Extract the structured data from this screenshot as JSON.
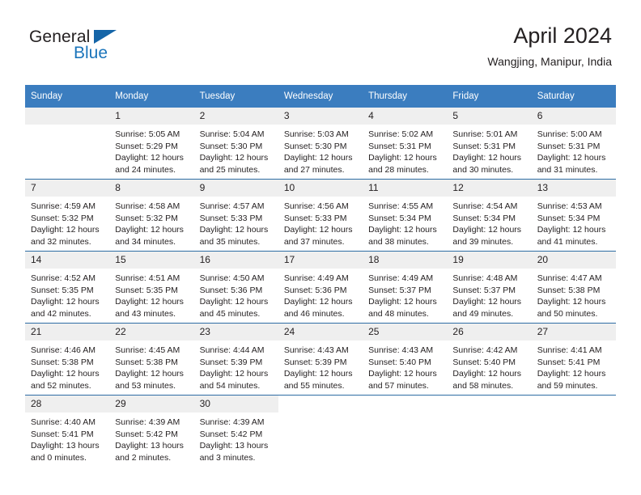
{
  "brand": {
    "name_part1": "General",
    "name_part2": "Blue",
    "accent_color": "#1b75bb"
  },
  "header": {
    "title": "April 2024",
    "subtitle": "Wangjing, Manipur, India"
  },
  "calendar": {
    "header_bg_color": "#3b7dbf",
    "daynum_bg_color": "#efefef",
    "separator_color": "#2e6da4",
    "weekday_headers": [
      "Sunday",
      "Monday",
      "Tuesday",
      "Wednesday",
      "Thursday",
      "Friday",
      "Saturday"
    ],
    "weeks": [
      [
        {
          "day": "",
          "lines": []
        },
        {
          "day": "1",
          "lines": [
            "Sunrise: 5:05 AM",
            "Sunset: 5:29 PM",
            "Daylight: 12 hours",
            "and 24 minutes."
          ]
        },
        {
          "day": "2",
          "lines": [
            "Sunrise: 5:04 AM",
            "Sunset: 5:30 PM",
            "Daylight: 12 hours",
            "and 25 minutes."
          ]
        },
        {
          "day": "3",
          "lines": [
            "Sunrise: 5:03 AM",
            "Sunset: 5:30 PM",
            "Daylight: 12 hours",
            "and 27 minutes."
          ]
        },
        {
          "day": "4",
          "lines": [
            "Sunrise: 5:02 AM",
            "Sunset: 5:31 PM",
            "Daylight: 12 hours",
            "and 28 minutes."
          ]
        },
        {
          "day": "5",
          "lines": [
            "Sunrise: 5:01 AM",
            "Sunset: 5:31 PM",
            "Daylight: 12 hours",
            "and 30 minutes."
          ]
        },
        {
          "day": "6",
          "lines": [
            "Sunrise: 5:00 AM",
            "Sunset: 5:31 PM",
            "Daylight: 12 hours",
            "and 31 minutes."
          ]
        }
      ],
      [
        {
          "day": "7",
          "lines": [
            "Sunrise: 4:59 AM",
            "Sunset: 5:32 PM",
            "Daylight: 12 hours",
            "and 32 minutes."
          ]
        },
        {
          "day": "8",
          "lines": [
            "Sunrise: 4:58 AM",
            "Sunset: 5:32 PM",
            "Daylight: 12 hours",
            "and 34 minutes."
          ]
        },
        {
          "day": "9",
          "lines": [
            "Sunrise: 4:57 AM",
            "Sunset: 5:33 PM",
            "Daylight: 12 hours",
            "and 35 minutes."
          ]
        },
        {
          "day": "10",
          "lines": [
            "Sunrise: 4:56 AM",
            "Sunset: 5:33 PM",
            "Daylight: 12 hours",
            "and 37 minutes."
          ]
        },
        {
          "day": "11",
          "lines": [
            "Sunrise: 4:55 AM",
            "Sunset: 5:34 PM",
            "Daylight: 12 hours",
            "and 38 minutes."
          ]
        },
        {
          "day": "12",
          "lines": [
            "Sunrise: 4:54 AM",
            "Sunset: 5:34 PM",
            "Daylight: 12 hours",
            "and 39 minutes."
          ]
        },
        {
          "day": "13",
          "lines": [
            "Sunrise: 4:53 AM",
            "Sunset: 5:34 PM",
            "Daylight: 12 hours",
            "and 41 minutes."
          ]
        }
      ],
      [
        {
          "day": "14",
          "lines": [
            "Sunrise: 4:52 AM",
            "Sunset: 5:35 PM",
            "Daylight: 12 hours",
            "and 42 minutes."
          ]
        },
        {
          "day": "15",
          "lines": [
            "Sunrise: 4:51 AM",
            "Sunset: 5:35 PM",
            "Daylight: 12 hours",
            "and 43 minutes."
          ]
        },
        {
          "day": "16",
          "lines": [
            "Sunrise: 4:50 AM",
            "Sunset: 5:36 PM",
            "Daylight: 12 hours",
            "and 45 minutes."
          ]
        },
        {
          "day": "17",
          "lines": [
            "Sunrise: 4:49 AM",
            "Sunset: 5:36 PM",
            "Daylight: 12 hours",
            "and 46 minutes."
          ]
        },
        {
          "day": "18",
          "lines": [
            "Sunrise: 4:49 AM",
            "Sunset: 5:37 PM",
            "Daylight: 12 hours",
            "and 48 minutes."
          ]
        },
        {
          "day": "19",
          "lines": [
            "Sunrise: 4:48 AM",
            "Sunset: 5:37 PM",
            "Daylight: 12 hours",
            "and 49 minutes."
          ]
        },
        {
          "day": "20",
          "lines": [
            "Sunrise: 4:47 AM",
            "Sunset: 5:38 PM",
            "Daylight: 12 hours",
            "and 50 minutes."
          ]
        }
      ],
      [
        {
          "day": "21",
          "lines": [
            "Sunrise: 4:46 AM",
            "Sunset: 5:38 PM",
            "Daylight: 12 hours",
            "and 52 minutes."
          ]
        },
        {
          "day": "22",
          "lines": [
            "Sunrise: 4:45 AM",
            "Sunset: 5:38 PM",
            "Daylight: 12 hours",
            "and 53 minutes."
          ]
        },
        {
          "day": "23",
          "lines": [
            "Sunrise: 4:44 AM",
            "Sunset: 5:39 PM",
            "Daylight: 12 hours",
            "and 54 minutes."
          ]
        },
        {
          "day": "24",
          "lines": [
            "Sunrise: 4:43 AM",
            "Sunset: 5:39 PM",
            "Daylight: 12 hours",
            "and 55 minutes."
          ]
        },
        {
          "day": "25",
          "lines": [
            "Sunrise: 4:43 AM",
            "Sunset: 5:40 PM",
            "Daylight: 12 hours",
            "and 57 minutes."
          ]
        },
        {
          "day": "26",
          "lines": [
            "Sunrise: 4:42 AM",
            "Sunset: 5:40 PM",
            "Daylight: 12 hours",
            "and 58 minutes."
          ]
        },
        {
          "day": "27",
          "lines": [
            "Sunrise: 4:41 AM",
            "Sunset: 5:41 PM",
            "Daylight: 12 hours",
            "and 59 minutes."
          ]
        }
      ],
      [
        {
          "day": "28",
          "lines": [
            "Sunrise: 4:40 AM",
            "Sunset: 5:41 PM",
            "Daylight: 13 hours",
            "and 0 minutes."
          ]
        },
        {
          "day": "29",
          "lines": [
            "Sunrise: 4:39 AM",
            "Sunset: 5:42 PM",
            "Daylight: 13 hours",
            "and 2 minutes."
          ]
        },
        {
          "day": "30",
          "lines": [
            "Sunrise: 4:39 AM",
            "Sunset: 5:42 PM",
            "Daylight: 13 hours",
            "and 3 minutes."
          ]
        },
        {
          "day": null,
          "lines": []
        },
        {
          "day": null,
          "lines": []
        },
        {
          "day": null,
          "lines": []
        },
        {
          "day": null,
          "lines": []
        }
      ]
    ]
  }
}
